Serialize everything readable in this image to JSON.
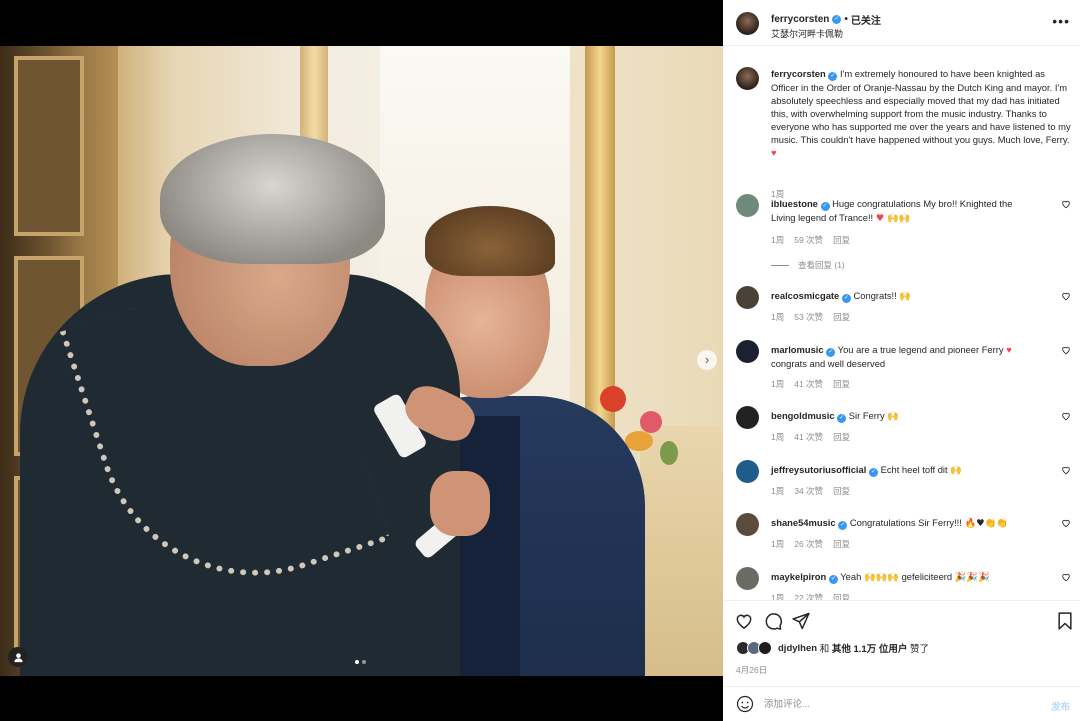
{
  "post": {
    "username": "ferrycorsten",
    "follow_dot": "•",
    "follow_label": "已关注",
    "location": "艾瑟尔河畔卡佩勒",
    "more_label": "•••"
  },
  "caption": {
    "username": "ferrycorsten",
    "text": "I'm extremely honoured to have been knighted as Officer in the Order of Oranje-Nassau by the Dutch King and mayor. I'm absolutely speechless and especially moved that my dad has initiated this, with overwhelming support from the music industry. Thanks to everyone who has supported me over the years and have listened to my music. This couldn't have happened without you guys. Much love, Ferry.",
    "heart": "♥",
    "time": "1周"
  },
  "comments": [
    {
      "username": "ibluestone",
      "text": "Huge congratulations My bro!! Knighted the Living legend of Trance!!",
      "emoji": "♥ 🙌🙌",
      "time": "1周",
      "likes": "59 次赞",
      "reply": "回复",
      "view_replies": "查看回复 (1)",
      "avatar_color": "#6f8a7a"
    },
    {
      "username": "realcosmicgate",
      "text": "Congrats!!",
      "emoji": "🙌",
      "time": "1周",
      "likes": "53 次赞",
      "reply": "回复",
      "avatar_color": "#4b4035"
    },
    {
      "username": "marlomusic",
      "text": "You are a true legend and pioneer Ferry",
      "emoji": "♥",
      "text2": "congrats and well deserved",
      "time": "1周",
      "likes": "41 次赞",
      "reply": "回复",
      "avatar_color": "#1c2130"
    },
    {
      "username": "bengoldmusic",
      "text": "Sir Ferry",
      "emoji": "🙌",
      "time": "1周",
      "likes": "41 次赞",
      "reply": "回复",
      "avatar_color": "#222222"
    },
    {
      "username": "jeffreysutoriusofficial",
      "text": "Echt heel toff dit",
      "emoji": "🙌",
      "time": "1周",
      "likes": "34 次赞",
      "reply": "回复",
      "avatar_color": "#1f5c8a"
    },
    {
      "username": "shane54music",
      "text": "Congratulations Sir Ferry!!!",
      "emoji": "🔥♥👏👏",
      "time": "1周",
      "likes": "26 次赞",
      "reply": "回复",
      "avatar_color": "#5a4b3c"
    },
    {
      "username": "maykelpiron",
      "text": "Yeah",
      "emoji": "🙌🙌🙌",
      "text2": "gefeliciteerd",
      "emoji2": "🎉🎉🎉",
      "time": "1周",
      "likes": "22 次赞",
      "reply": "回复",
      "avatar_color": "#6b6b63"
    }
  ],
  "likes": {
    "user": "djdylhen",
    "conj": "和",
    "others": "其他 1.1万 位用户",
    "suffix": "赞了"
  },
  "date": "4月26日",
  "add_comment": {
    "placeholder": "添加评论...",
    "post_label": "发布"
  },
  "icons": {
    "verified": "verified-badge-icon",
    "more": "more-options-icon",
    "like": "heart-icon",
    "comment": "comment-icon",
    "share": "share-icon",
    "save": "bookmark-icon",
    "emoji": "emoji-icon",
    "next": "chevron-right-icon",
    "tag": "user-tag-icon"
  },
  "colors": {
    "verified": "#3897f0",
    "heart": "#ed4956",
    "muted": "#8e8e8e",
    "post_button": "#b3dbff"
  }
}
